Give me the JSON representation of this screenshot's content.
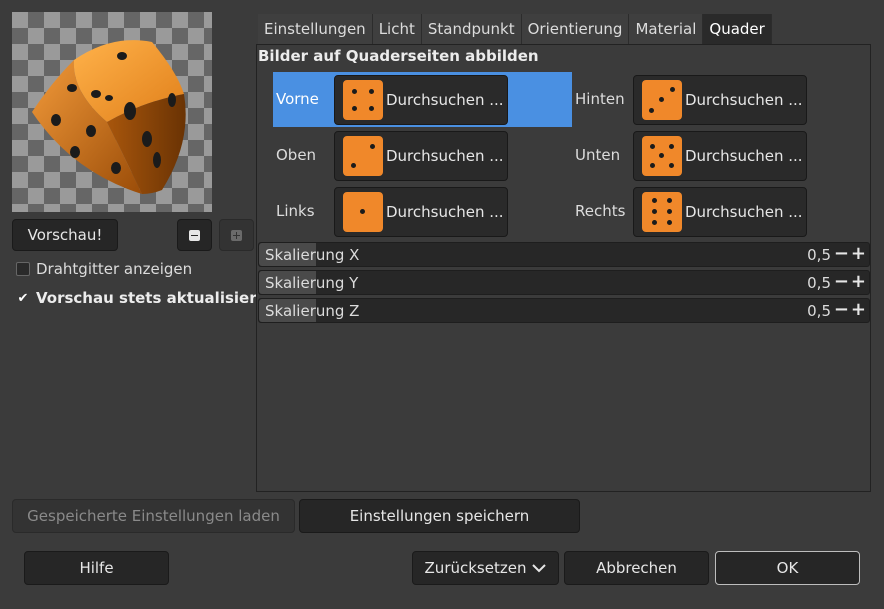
{
  "preview": {
    "button_label": "Vorschau!",
    "wireframe_label": "Drahtgitter anzeigen",
    "wireframe_checked": false,
    "always_update_label": "Vorschau stets aktualisieren",
    "always_update_checked": true
  },
  "tabs": [
    "Einstellungen",
    "Licht",
    "Standpunkt",
    "Orientierung",
    "Material",
    "Quader"
  ],
  "active_tab": "Quader",
  "section_title": "Bilder auf Quaderseiten abbilden",
  "faces": {
    "browse_label": "Durchsuchen ...",
    "vorne": "Vorne",
    "hinten": "Hinten",
    "oben": "Oben",
    "unten": "Unten",
    "links": "Links",
    "rechts": "Rechts"
  },
  "scales": [
    {
      "label": "Skalierung X",
      "value": "0,5",
      "minus": "−",
      "plus": "+"
    },
    {
      "label": "Skalierung Y",
      "value": "0,5",
      "minus": "−",
      "plus": "+"
    },
    {
      "label": "Skalierung Z",
      "value": "0,5",
      "minus": "−",
      "plus": "+"
    }
  ],
  "footer": {
    "load_label": "Gespeicherte Einstellungen laden",
    "save_label": "Einstellungen speichern",
    "help_label": "Hilfe",
    "reset_label": "Zurücksetzen",
    "cancel_label": "Abbrechen",
    "ok_label": "OK"
  },
  "colors": {
    "die_orange": "#f0882a",
    "selection_blue": "#4a90e2"
  }
}
